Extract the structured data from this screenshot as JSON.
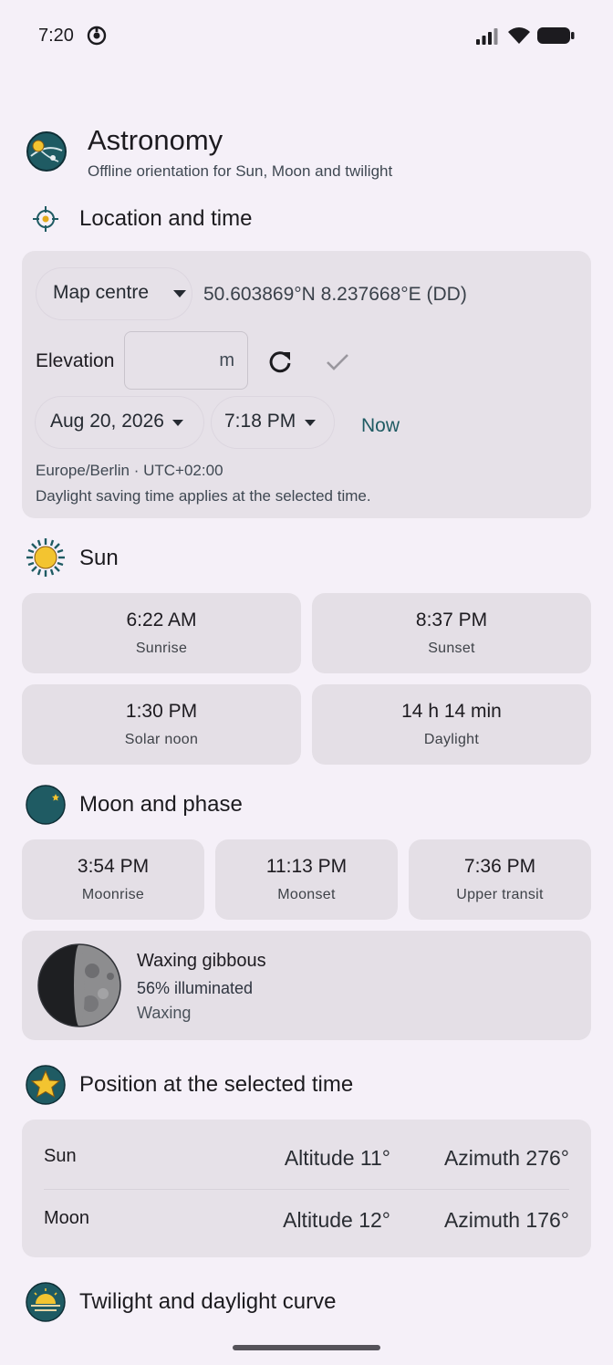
{
  "status_bar": {
    "time": "7:20"
  },
  "header": {
    "title": "Astronomy",
    "subtitle": "Offline orientation for Sun, Moon and twilight"
  },
  "location": {
    "heading": "Location and time",
    "source_label": "Map centre",
    "coords": "50.603869°N 8.237668°E (DD)",
    "elevation_label": "Elevation",
    "elevation_value": "",
    "elevation_unit": "m",
    "date": "Aug 20, 2026",
    "time": "7:18 PM",
    "now_label": "Now",
    "timezone": "Europe/Berlin · UTC+02:00",
    "dst_note": "Daylight saving time applies at the selected time."
  },
  "sun": {
    "heading": "Sun",
    "tiles": [
      {
        "value": "6:22 AM",
        "label": "Sunrise"
      },
      {
        "value": "8:37 PM",
        "label": "Sunset"
      },
      {
        "value": "1:30 PM",
        "label": "Solar noon"
      },
      {
        "value": "14 h 14 min",
        "label": "Daylight"
      }
    ]
  },
  "moon": {
    "heading": "Moon and phase",
    "tiles": [
      {
        "value": "3:54 PM",
        "label": "Moonrise"
      },
      {
        "value": "11:13 PM",
        "label": "Moonset"
      },
      {
        "value": "7:36 PM",
        "label": "Upper transit"
      }
    ],
    "phase_name": "Waxing gibbous",
    "illumination": "56% illuminated",
    "trend": "Waxing"
  },
  "position": {
    "heading": "Position at the selected time",
    "rows": [
      {
        "body": "Sun",
        "altitude": "Altitude 11°",
        "azimuth": "Azimuth 276°"
      },
      {
        "body": "Moon",
        "altitude": "Altitude 12°",
        "azimuth": "Azimuth 176°"
      }
    ]
  },
  "twilight": {
    "heading": "Twilight and daylight curve"
  },
  "colors": {
    "background": "#f5f0f8",
    "card": "#e6e1e8",
    "accent_teal": "#1f5b63",
    "sun_yellow": "#f3c430"
  },
  "icons": {
    "status": [
      "focus-mode-icon",
      "signal-icon",
      "wifi-icon",
      "battery-icon"
    ],
    "header": "astronomy-logo-icon",
    "location": "crosshair-icon",
    "sun": "sun-icon",
    "moon": "crescent-moon-icon",
    "position": "star-icon",
    "twilight": "sunset-horizon-icon"
  }
}
